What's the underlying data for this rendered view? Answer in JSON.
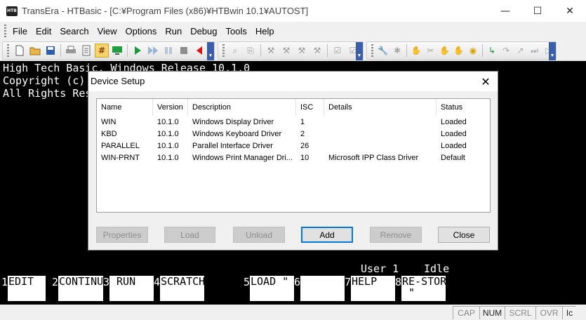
{
  "window": {
    "app_icon_text": "HTB",
    "title": "TransEra - HTBasic - [C:¥Program Files (x86)¥HTBwin 10.1¥AUTOST]",
    "minimize": "—",
    "maximize": "☐",
    "close": "✕"
  },
  "menu": [
    "File",
    "Edit",
    "Search",
    "View",
    "Options",
    "Run",
    "Debug",
    "Tools",
    "Help"
  ],
  "toolbar_icons": [
    "new-icon",
    "open-icon",
    "save-icon",
    "print-icon",
    "edit-icon",
    "grid-icon",
    "monitor-icon",
    "run-icon",
    "continue-icon",
    "pause-icon",
    "stop-icon",
    "step-back-icon",
    "find-icon",
    "replace-icon",
    "tool-1-icon",
    "tool-2-icon",
    "tool-3-icon",
    "check-1-icon",
    "check-2-icon",
    "wrench-icon",
    "bug-icon",
    "hand-icon",
    "hand-2-icon",
    "hand-3-icon",
    "globe-icon",
    "arrow-1-icon",
    "arrow-2-icon",
    "arrow-3-icon",
    "arrow-4-icon",
    "arrow-5-icon"
  ],
  "terminal": {
    "lines": [
      "High Tech Basic, Windows Release 10.1.0",
      "Copyright (c) TransEra",
      "All Rights Reserved"
    ],
    "status_user": "User 1",
    "status_state": "Idle",
    "softkeys": [
      {
        "num": "1",
        "label": "EDIT"
      },
      {
        "num": "2",
        "label": "CONTINUE"
      },
      {
        "num": "3",
        "label": " RUN"
      },
      {
        "num": "4",
        "label": "SCRATCH"
      },
      {
        "num": "5",
        "label": "LOAD \""
      },
      {
        "num": "6",
        "label": ""
      },
      {
        "num": "7",
        "label": "HELP"
      },
      {
        "num": "8",
        "label": "RE-STORE\n \""
      }
    ]
  },
  "statusbar": [
    "CAP",
    "NUM",
    "SCRL",
    "OVR",
    "Ic"
  ],
  "dialog": {
    "title": "Device Setup",
    "close": "✕",
    "columns": [
      "Name",
      "Version",
      "Description",
      "ISC",
      "Details",
      "Status"
    ],
    "rows": [
      [
        "WIN",
        "10.1.0",
        "Windows Display Driver",
        "1",
        "",
        "Loaded"
      ],
      [
        "KBD",
        "10.1.0",
        "Windows Keyboard Driver",
        "2",
        "",
        "Loaded"
      ],
      [
        "PARALLEL",
        "10.1.0",
        "Parallel Interface Driver",
        "26",
        "",
        "Loaded"
      ],
      [
        "WIN-PRNT",
        "10.1.0",
        "Windows Print Manager Dri...",
        "10",
        "Microsoft IPP Class Driver",
        "Default"
      ]
    ],
    "buttons": {
      "properties": "Properties",
      "load": "Load",
      "unload": "Unload",
      "add": "Add",
      "remove": "Remove",
      "close": "Close"
    }
  }
}
